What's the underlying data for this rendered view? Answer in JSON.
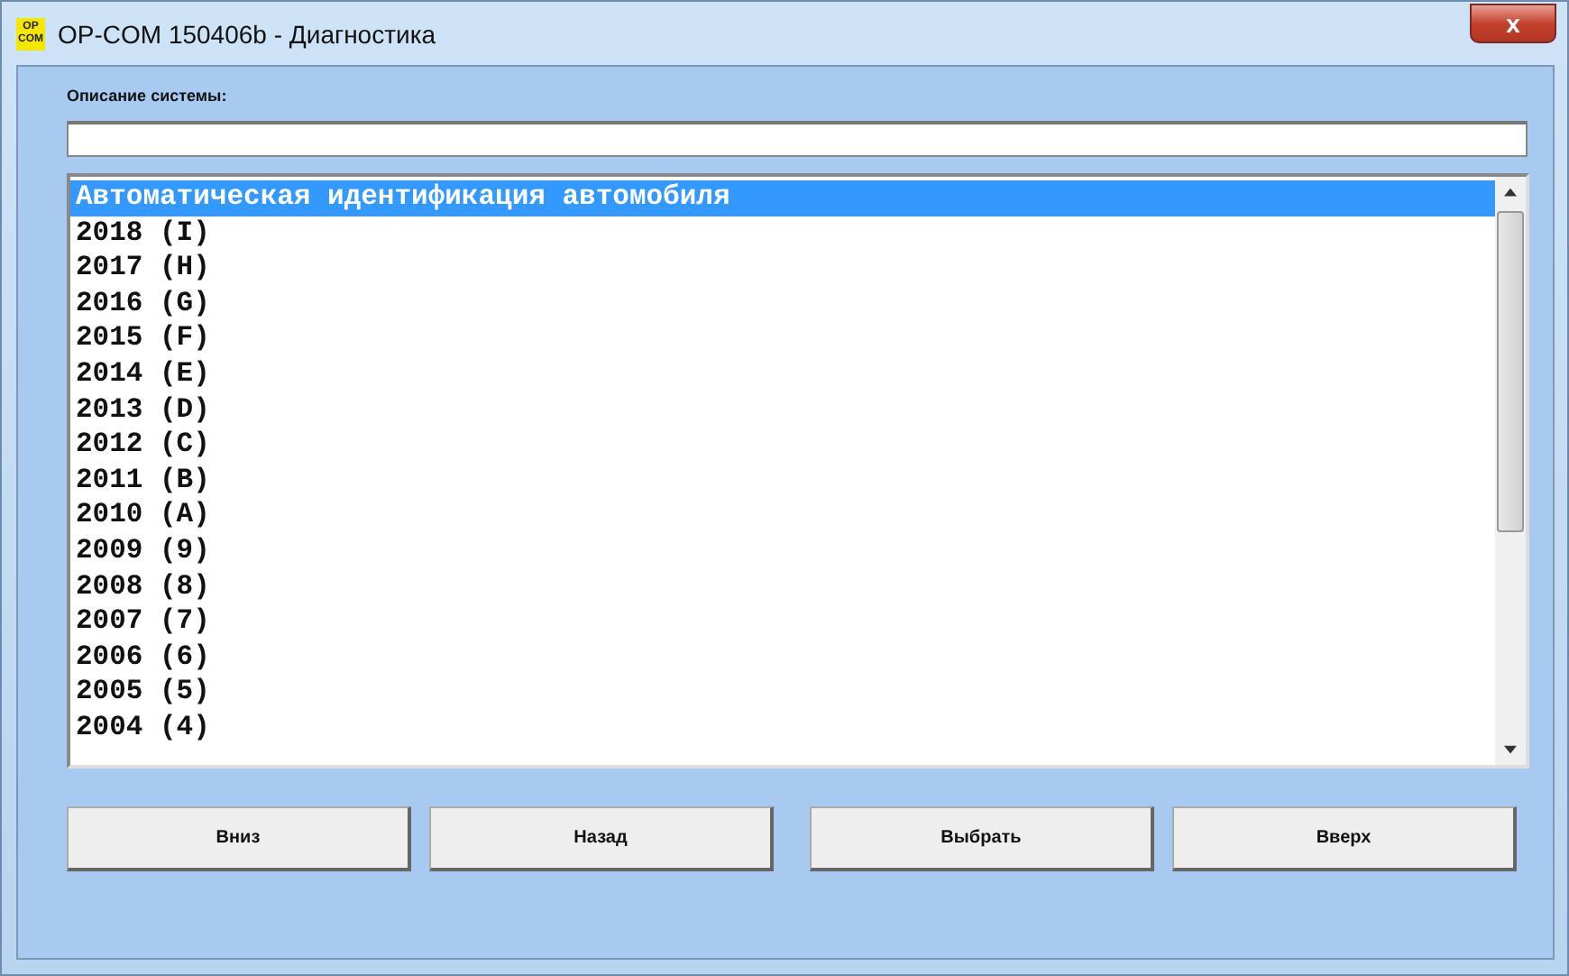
{
  "window": {
    "title": "OP-COM 150406b - Диагностика",
    "logo": [
      "OP",
      "COM"
    ],
    "close": "x"
  },
  "description": {
    "label": "Описание системы:"
  },
  "list": {
    "items": [
      {
        "text": "Автоматическая идентификация автомобиля",
        "selected": true
      },
      {
        "text": "2018 (I)",
        "selected": false
      },
      {
        "text": "2017 (H)",
        "selected": false
      },
      {
        "text": "2016 (G)",
        "selected": false
      },
      {
        "text": "2015 (F)",
        "selected": false
      },
      {
        "text": "2014 (E)",
        "selected": false
      },
      {
        "text": "2013 (D)",
        "selected": false
      },
      {
        "text": "2012 (C)",
        "selected": false
      },
      {
        "text": "2011 (B)",
        "selected": false
      },
      {
        "text": "2010 (A)",
        "selected": false
      },
      {
        "text": "2009 (9)",
        "selected": false
      },
      {
        "text": "2008 (8)",
        "selected": false
      },
      {
        "text": "2007 (7)",
        "selected": false
      },
      {
        "text": "2006 (6)",
        "selected": false
      },
      {
        "text": "2005 (5)",
        "selected": false
      },
      {
        "text": "2004 (4)",
        "selected": false
      }
    ]
  },
  "buttons": [
    "Вниз",
    "Назад",
    "Выбрать",
    "Вверх"
  ]
}
